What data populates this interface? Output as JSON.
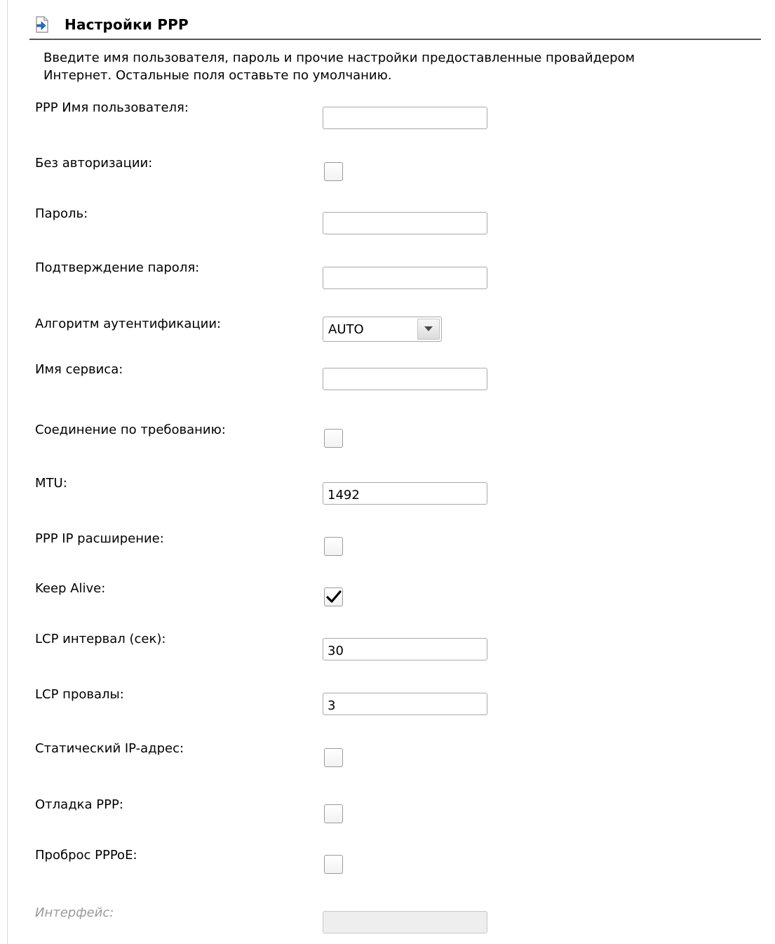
{
  "header": {
    "title": "Настройки PPP",
    "icon": "page-arrow-icon"
  },
  "description": {
    "line1": "Введите имя пользователя, пароль и прочие настройки предоставленные провайдером",
    "line2": "Интернет. Остальные поля оставьте по умолчанию."
  },
  "fields": {
    "ppp_username": {
      "label": "PPP Имя пользователя:",
      "value": ""
    },
    "no_auth": {
      "label": "Без авторизации:",
      "checked": false
    },
    "password": {
      "label": "Пароль:",
      "value": ""
    },
    "password_confirm": {
      "label": "Подтверждение пароля:",
      "value": ""
    },
    "auth_algorithm": {
      "label": "Алгоритм аутентификации:",
      "selected": "AUTO"
    },
    "service_name": {
      "label": "Имя сервиса:",
      "value": ""
    },
    "on_demand": {
      "label": "Соединение по требованию:",
      "checked": false
    },
    "mtu": {
      "label": "MTU:",
      "value": "1492"
    },
    "ppp_ip_extension": {
      "label": "PPP IP расширение:",
      "checked": false
    },
    "keep_alive": {
      "label": "Keep Alive:",
      "checked": true
    },
    "lcp_interval": {
      "label": "LCP интервал (сек):",
      "value": "30"
    },
    "lcp_failures": {
      "label": "LCP провалы:",
      "value": "3"
    },
    "static_ip": {
      "label": "Статический IP-адрес:",
      "checked": false
    },
    "ppp_debug": {
      "label": "Отладка PPP:",
      "checked": false
    },
    "pppoe_passthrough": {
      "label": "Проброс PPPoE:",
      "checked": false
    },
    "interface": {
      "label": "Интерфейс:",
      "value": "",
      "disabled": true
    }
  }
}
